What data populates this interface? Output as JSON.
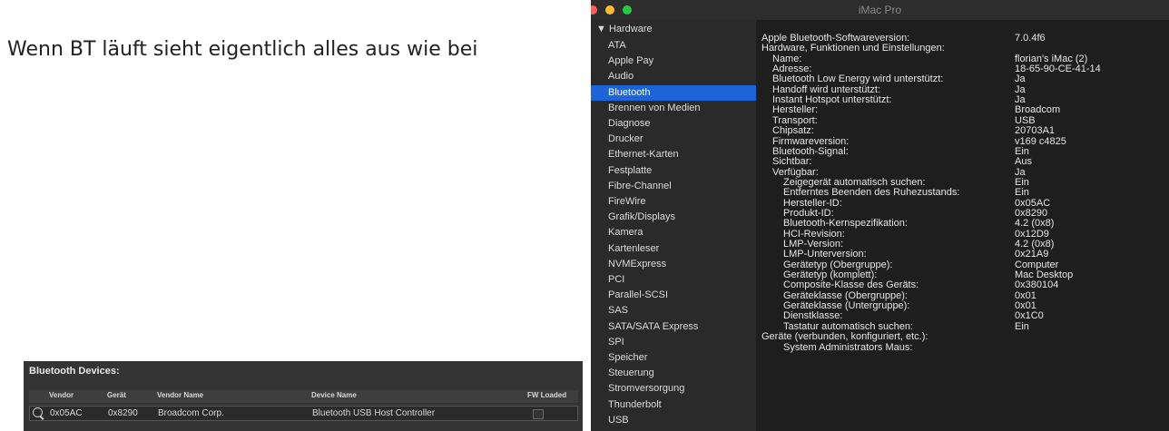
{
  "post": {
    "text": "Wenn BT läuft sieht eigentlich alles aus wie bei"
  },
  "window": {
    "title": "iMac Pro"
  },
  "sidebar": {
    "group_label": "▼ Hardware",
    "selected": "Bluetooth",
    "items": [
      "ATA",
      "Apple Pay",
      "Audio",
      "Bluetooth",
      "Brennen von Medien",
      "Diagnose",
      "Drucker",
      "Ethernet-Karten",
      "Festplatte",
      "Fibre-Channel",
      "FireWire",
      "Grafik/Displays",
      "Kamera",
      "Kartenleser",
      "NVMExpress",
      "PCI",
      "Parallel-SCSI",
      "SAS",
      "SATA/SATA Express",
      "SPI",
      "Speicher",
      "Steuerung",
      "Stromversorgung",
      "Thunderbolt",
      "USB"
    ]
  },
  "details": {
    "rows": [
      {
        "k": "Apple Bluetooth-Softwareversion:",
        "v": "7.0.4f6",
        "indent": 0
      },
      {
        "k": "Hardware, Funktionen und Einstellungen:",
        "v": "",
        "indent": 0
      },
      {
        "k": "Name:",
        "v": "florian's iMac (2)",
        "indent": 1
      },
      {
        "k": "Adresse:",
        "v": "18-65-90-CE-41-14",
        "indent": 1
      },
      {
        "k": "Bluetooth Low Energy wird unterstützt:",
        "v": "Ja",
        "indent": 1
      },
      {
        "k": "Handoff wird unterstützt:",
        "v": "Ja",
        "indent": 1
      },
      {
        "k": "Instant Hotspot unterstützt:",
        "v": "Ja",
        "indent": 1
      },
      {
        "k": "Hersteller:",
        "v": "Broadcom",
        "indent": 1
      },
      {
        "k": "Transport:",
        "v": "USB",
        "indent": 1
      },
      {
        "k": "Chipsatz:",
        "v": "20703A1",
        "indent": 1
      },
      {
        "k": "Firmwareversion:",
        "v": "v169 c4825",
        "indent": 1
      },
      {
        "k": "Bluetooth-Signal:",
        "v": "Ein",
        "indent": 1
      },
      {
        "k": "Sichtbar:",
        "v": "Aus",
        "indent": 1
      },
      {
        "k": "Verfügbar:",
        "v": "Ja",
        "indent": 1
      },
      {
        "k": "Zeigegerät automatisch suchen:",
        "v": "Ein",
        "indent": 2
      },
      {
        "k": "Entferntes Beenden des Ruhezustands:",
        "v": "Ein",
        "indent": 2
      },
      {
        "k": "Hersteller-ID:",
        "v": "0x05AC",
        "indent": 2
      },
      {
        "k": "Produkt-ID:",
        "v": "0x8290",
        "indent": 2
      },
      {
        "k": "Bluetooth-Kernspezifikation:",
        "v": "4.2 (0x8)",
        "indent": 2
      },
      {
        "k": "HCI-Revision:",
        "v": "0x12D9",
        "indent": 2
      },
      {
        "k": "LMP-Version:",
        "v": "4.2 (0x8)",
        "indent": 2
      },
      {
        "k": "LMP-Unterversion:",
        "v": "0x21A9",
        "indent": 2
      },
      {
        "k": "Gerätetyp (Obergruppe):",
        "v": "Computer",
        "indent": 2
      },
      {
        "k": "Gerätetyp (komplett):",
        "v": "Mac Desktop",
        "indent": 2
      },
      {
        "k": "Composite-Klasse des Geräts:",
        "v": "0x380104",
        "indent": 2
      },
      {
        "k": "Geräteklasse (Obergruppe):",
        "v": "0x01",
        "indent": 2
      },
      {
        "k": "Geräteklasse (Untergruppe):",
        "v": "0x01",
        "indent": 2
      },
      {
        "k": "Dienstklasse:",
        "v": "0x1C0",
        "indent": 2
      },
      {
        "k": "Tastatur automatisch suchen:",
        "v": "Ein",
        "indent": 2
      },
      {
        "k": "Geräte (verbunden, konfiguriert, etc.):",
        "v": "",
        "indent": 0
      },
      {
        "k": "System Administrators Maus:",
        "v": "",
        "indent": 2
      }
    ]
  },
  "bt_devices": {
    "title": "Bluetooth Devices:",
    "columns": [
      "Vendor",
      "Gerät",
      "Vendor Name",
      "Device Name",
      "FW Loaded"
    ],
    "rows": [
      {
        "vendor": "0x05AC",
        "geraet": "0x8290",
        "vendor_name": "Broadcom Corp.",
        "device_name": "Bluetooth USB Host Controller"
      }
    ]
  }
}
